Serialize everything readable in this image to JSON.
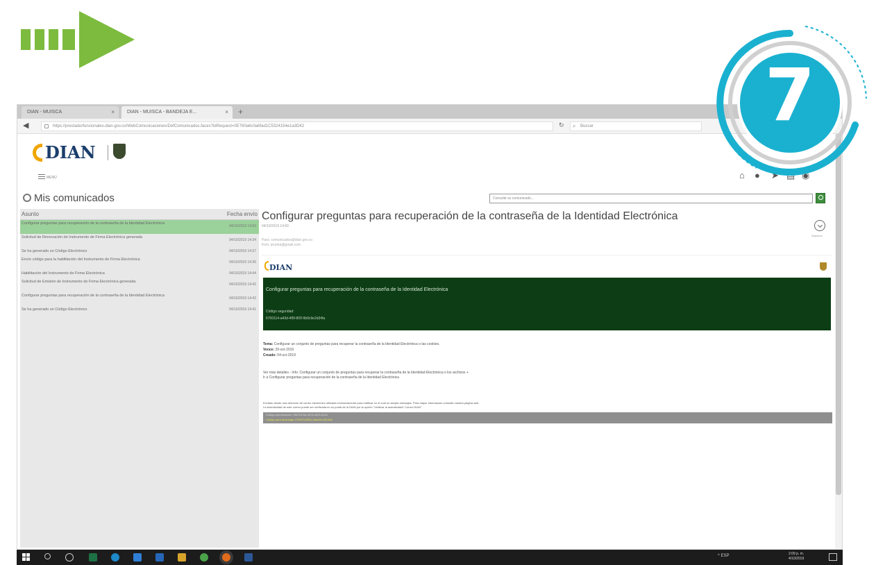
{
  "step": {
    "number": "7"
  },
  "colors": {
    "step_arrow": "#7dbb3f",
    "badge": "#1ab1d0",
    "banner": "#0d3d14",
    "selected_row": "#9bd19a"
  },
  "browser": {
    "tabs": [
      {
        "label": "DIAN - MUISCA"
      },
      {
        "label": "DIAN - MUISCA - BANDEJA E..."
      }
    ],
    "url": "https://prestadorfuncionales.dian.gov.co/WebComunicaciones/DefComunicados.faces?idRequest=0E760a6c0a6fad1C5324154e1a3D42",
    "search_placeholder": "Buscar"
  },
  "site": {
    "logo_text": "DIAN",
    "menu_label": "MENÚ"
  },
  "inbox": {
    "title": "Mis comunicados",
    "search_placeholder": "Consulte su comunicado...",
    "col_subject": "Asunto",
    "col_date": "Fecha envío",
    "rows": [
      {
        "subject": "Configurar preguntas para recuperación de la contraseña de la Identidad Electrónica",
        "date": "04/10/2019 14:50"
      },
      {
        "subject": "Solicitud de Renovación de Instrumento de Firma Electrónica generada",
        "date": "04/10/2019 14:34"
      },
      {
        "subject": "Se ha generado un Código Electrónico",
        "date": "04/10/2019 14:37"
      },
      {
        "subject": "Envío código para la habilitación del Instrumento de Firma Electrónica",
        "date": "04/10/2019 14:36"
      },
      {
        "subject": "Habilitación del Instrumento de Firma Electrónica",
        "date": "04/10/2019 14:44"
      },
      {
        "subject": "Solicitud de Emisión de Instrumento de Firma Electrónica generada",
        "date": "04/10/2019 14:42"
      },
      {
        "subject": "Configurar preguntas para recuperación de la contraseña de la Identidad Electrónica",
        "date": "04/10/2019 14:42"
      },
      {
        "subject": "Se ha generado un Código Electrónico",
        "date": "04/10/2019 14:41"
      }
    ]
  },
  "message": {
    "title": "Configurar preguntas para recuperación de la contraseña de la Identidad Electrónica",
    "date": "04/10/2019 14:50",
    "to": "Para: comunicados@dian.gov.co",
    "from": "from: prueba@gmail.com",
    "download_label": "Adjuntos",
    "email_logo": "DIAN",
    "banner_title": "Configurar preguntas para recuperación de la contraseña de la Identidad Electrónica",
    "banner_code_label": "Código seguridad:",
    "banner_code": "6700114-a43d-4f5f-8f2f-9b9c9e2d34fa",
    "tema_label": "Tema:",
    "tema": "Configurar un conjunto de preguntas para recuperar la contraseña de la Identidad Electrónica o las cookies.",
    "vence_label": "Vence:",
    "vence": "29-oct-2019",
    "creado_label": "Creado:",
    "creado": "04-oct-2019",
    "more_info_1": "Ver más detalles - Info: Configurar un conjunto de preguntas para recuperar la contraseña de la Identidad Electrónica o los archivos +",
    "more_info_2": "Ir a Configurar preguntas para recuperación de la contraseña de la Identidad Electrónica",
    "notice_1": "Enviado desde una dirección de correo electrónico utilizada exclusivamente para notificar en el cual no acepta mensajes. Para mayor información consulte nuestra página web.",
    "notice_2": "La Autenticidad de este correo puede ser verificada en su portal de la DIAN por la opción \"Verificar la autenticidad\" Correo DIAN\"",
    "footer_1": "Código autenticación: 5f3CDC5d-4b78-4d25-4b34",
    "footer_2": "Código para descargar 4789C3-58Dc-4aac5e-4f0-9de"
  },
  "taskbar": {
    "tray": "^  ESP",
    "time": "2:09 p. m.",
    "date": "4/10/2019"
  }
}
